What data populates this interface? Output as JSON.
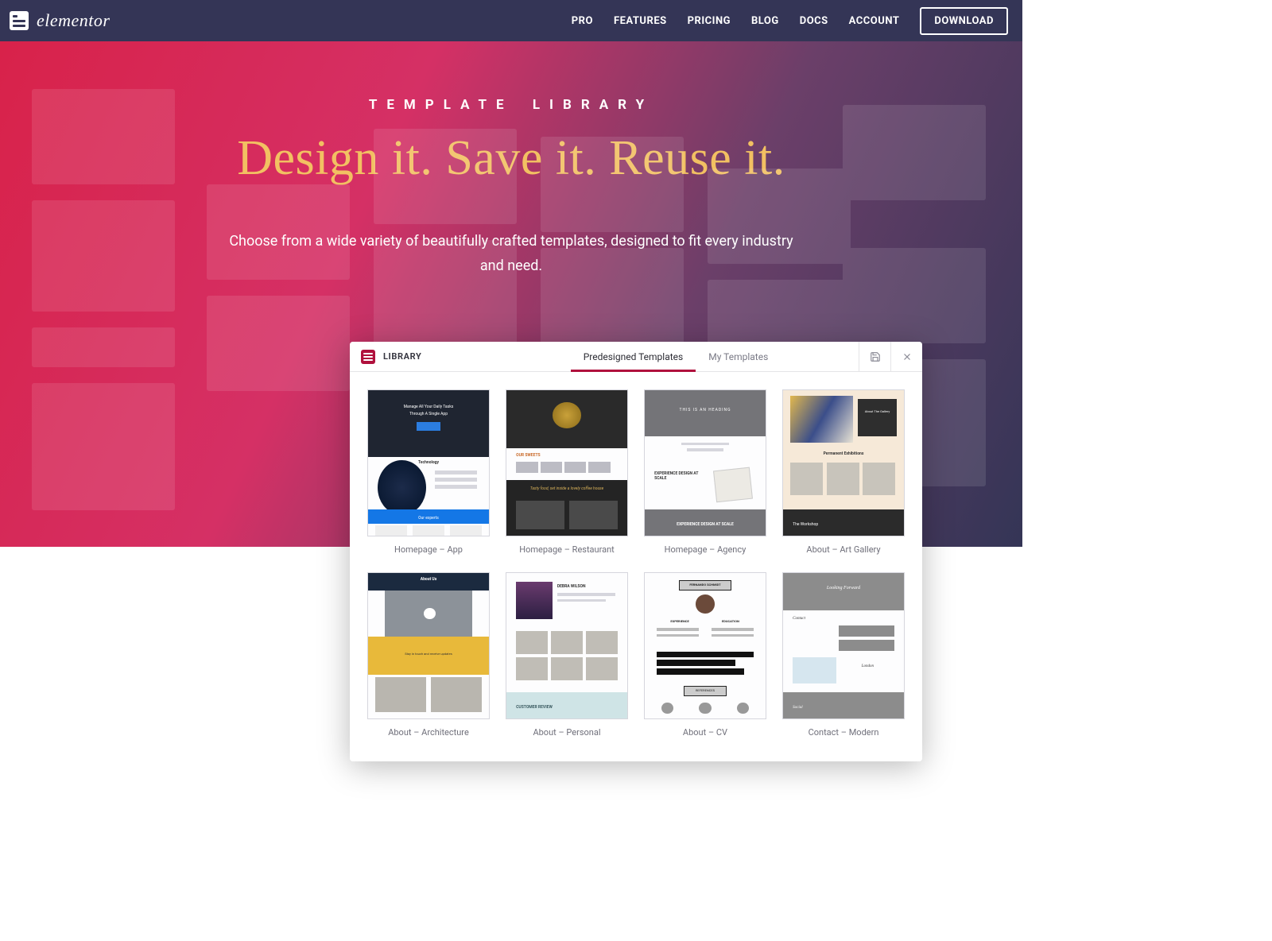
{
  "brand": {
    "name": "elementor"
  },
  "nav": {
    "links": [
      "PRO",
      "FEATURES",
      "PRICING",
      "BLOG",
      "DOCS",
      "ACCOUNT"
    ],
    "cta": "DOWNLOAD"
  },
  "hero": {
    "eyebrow": "TEMPLATE LIBRARY",
    "headline": "Design it. Save it. Reuse it.",
    "sub": "Choose from a wide variety of beautifully crafted templates, designed to fit every industry and need."
  },
  "panel": {
    "title": "LIBRARY",
    "tabs": [
      {
        "label": "Predesigned Templates",
        "active": true
      },
      {
        "label": "My Templates",
        "active": false
      }
    ],
    "actions": {
      "save_icon": "save-icon",
      "close_icon": "close-icon"
    },
    "templates": [
      {
        "label": "Homepage – App"
      },
      {
        "label": "Homepage – Restaurant"
      },
      {
        "label": "Homepage – Agency"
      },
      {
        "label": "About – Art Gallery"
      },
      {
        "label": "About – Architecture"
      },
      {
        "label": "About – Personal"
      },
      {
        "label": "About – CV"
      },
      {
        "label": "Contact – Modern"
      }
    ]
  },
  "thumb_text": {
    "t1a": "Manage All Your Daily Tasks",
    "t1b": "Through A Single App",
    "t1c": "Technology",
    "t1d": "Our experts",
    "t2a": "OUR SWEETS",
    "t2b": "Tasty food, set inside a lovely coffee house",
    "t3a": "THIS IS AN HEADING",
    "t3b": "EXPERIENCE DESIGN AT SCALE",
    "t3c": "EXPERIENCE DESIGN AT SCALE",
    "t4a": "About The Gallery",
    "t4b": "Permanent Exhibitions",
    "t4c": "The Workshop",
    "t5a": "About Us",
    "t5b": "Stay in touch and receive updates",
    "t6a": "DEBRA WILSON",
    "t6b": "CUSTOMER REVIEW",
    "t7a": "FERNANDO SCHMIDT",
    "t7b": "EXPERIENCE",
    "t7c": "EDUCATION",
    "t7d": "REFERENCES",
    "t8a": "Looking Forward",
    "t8b": "Contact",
    "t8c": "London",
    "t8d": "Social"
  }
}
